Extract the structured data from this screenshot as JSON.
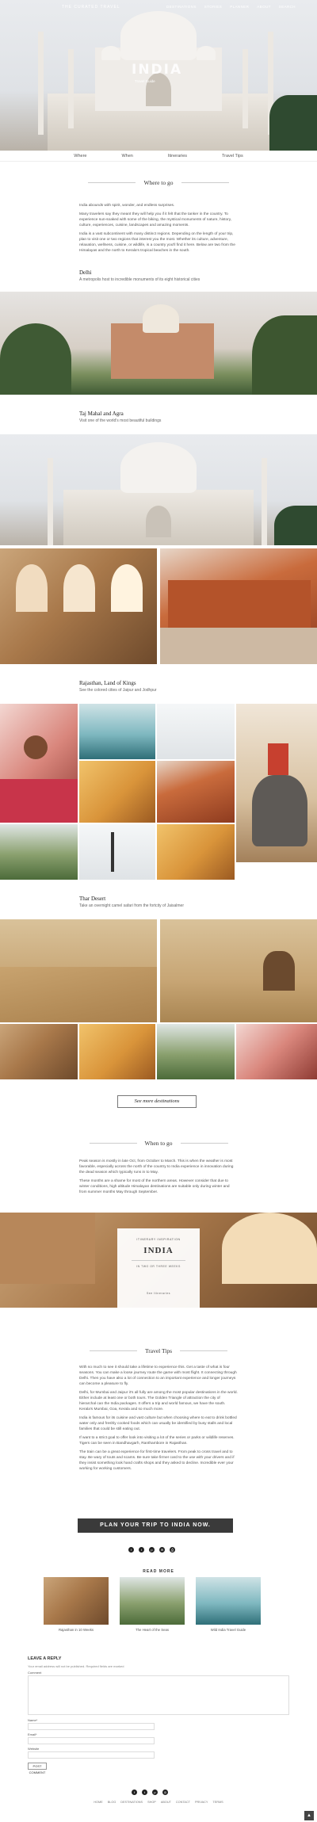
{
  "header": {
    "brand": "THE CURATED TRAVEL",
    "nav": [
      "DESTINATIONS",
      "STORIES",
      "PLANNER",
      "ABOUT",
      "SEARCH"
    ],
    "hero_title": "INDIA",
    "hero_sub": "Travel Guide"
  },
  "tabs": [
    "Where",
    "When",
    "Itineraries",
    "Travel Tips"
  ],
  "where": {
    "heading": "Where to go",
    "paragraphs": [
      "India abounds with spirit, wonder, and endless surprises.",
      "Many travelers say they meant they will help you if it felt that the tanker in the country. To experience sun-soaked with some of the biking, the mystical monuments of nature, history, culture, experiences, cuisine, landscapes and amazing moments.",
      "India is a vast subcontinent with many distinct regions. Depending on the length of your trip, plan to visit one or two regions that interest you the most. Whether its culture, adventure, relaxation, wellness, cuisine, or wildlife, is a country you'll find it here. Below are two from the Himalayas and the north to Kerala's tropical beaches in the south."
    ]
  },
  "destinations": [
    {
      "title": "Delhi",
      "sub": "A metropolis host to incredible monuments of its eight historical cities"
    },
    {
      "title": "Taj Mahal and Agra",
      "sub": "Visit one of the world's most beautiful buildings"
    },
    {
      "title": "Rajasthan, Land of Kings",
      "sub": "See the colored cities of Jaipur and Jodhpur"
    },
    {
      "title": "Thar Desert",
      "sub": "Take an overnight camel safari from the fortcity of Jaisalmer"
    }
  ],
  "see_more": "See more destinations",
  "when": {
    "heading": "When to go",
    "paragraphs": [
      "Peak season is mostly in late Oct, from October to March. This is when the weather is most favorable, especially across the north of the country to India experience in innovation during the dead season which typically runs in to May.",
      "These months are a shame for most of the northern areas. However consider that due to winter conditions, high altitude Himalayan destinations are suitable only during winter and from summer months May through September."
    ],
    "card": {
      "kicker": "ITINERARY INSPIRATION",
      "title": "INDIA",
      "line1": "IN TWO OR THREE WEEKS",
      "line2": "See Itineraries"
    }
  },
  "tips": {
    "heading": "Travel Tips",
    "paragraphs": [
      "With so much to see it should take a lifetime to experience this. Get a taste of what is four seasons. You can make a loose journey route the game with most flight. It connecting through Delhi. Then you have also a lot of connection to an important experience and longer journeys can become a pleasure to fly.",
      "Delhi, for Mumbai and Jaipur it's all fully are among the most popular destinations in the world. Either include at least one or both tours. The Golden Triangle of attraction the city of hierarchal can the India packages. It offers a trip and world famous, we have the south. Kerala's Mumbai, Goa, Kerala and so much more.",
      "India is famous for its cuisine and vast culture but when choosing where to eat to drink bottled water only and freshly cooked foods which can usually be identified by busy stalls and local families that could be still eating out.",
      "If want to a strict goal to offer look into visiting a lot of the series or parks or wildlife reserves. Tigers can be seen in Bandhavgarh, Ranthambore in Rajasthan.",
      "The train can be a great experience for first-time travelers. From peak to cross travel and to stay. Be wary of touts and scams. Be sure take firmer card to the use with your drivers and if they insist something look hand crafts shops and they asked to decline. Incredible ever your working for working customers."
    ],
    "cta": "PLAN YOUR TRIP TO INDIA NOW."
  },
  "share_icons": [
    "facebook-icon",
    "twitter-icon",
    "pinterest-icon",
    "mail-icon",
    "print-icon"
  ],
  "read_more": {
    "label": "READ MORE",
    "items": [
      "Rajasthan in 10 Weeks",
      "The Heart of the Seas",
      "Wild India Travel Guide"
    ]
  },
  "reply": {
    "title": "LEAVE A REPLY",
    "note": "Your email address will not be published. Required fields are marked",
    "comment_label": "Comment",
    "name_label": "Name*",
    "email_label": "Email*",
    "website_label": "Website",
    "submit": "POST COMMENT"
  },
  "footer": {
    "links": [
      "HOME",
      "BLOG",
      "DESTINATIONS",
      "SHOP",
      "ABOUT",
      "CONTACT",
      "PRIVACY",
      "TERMS"
    ]
  }
}
